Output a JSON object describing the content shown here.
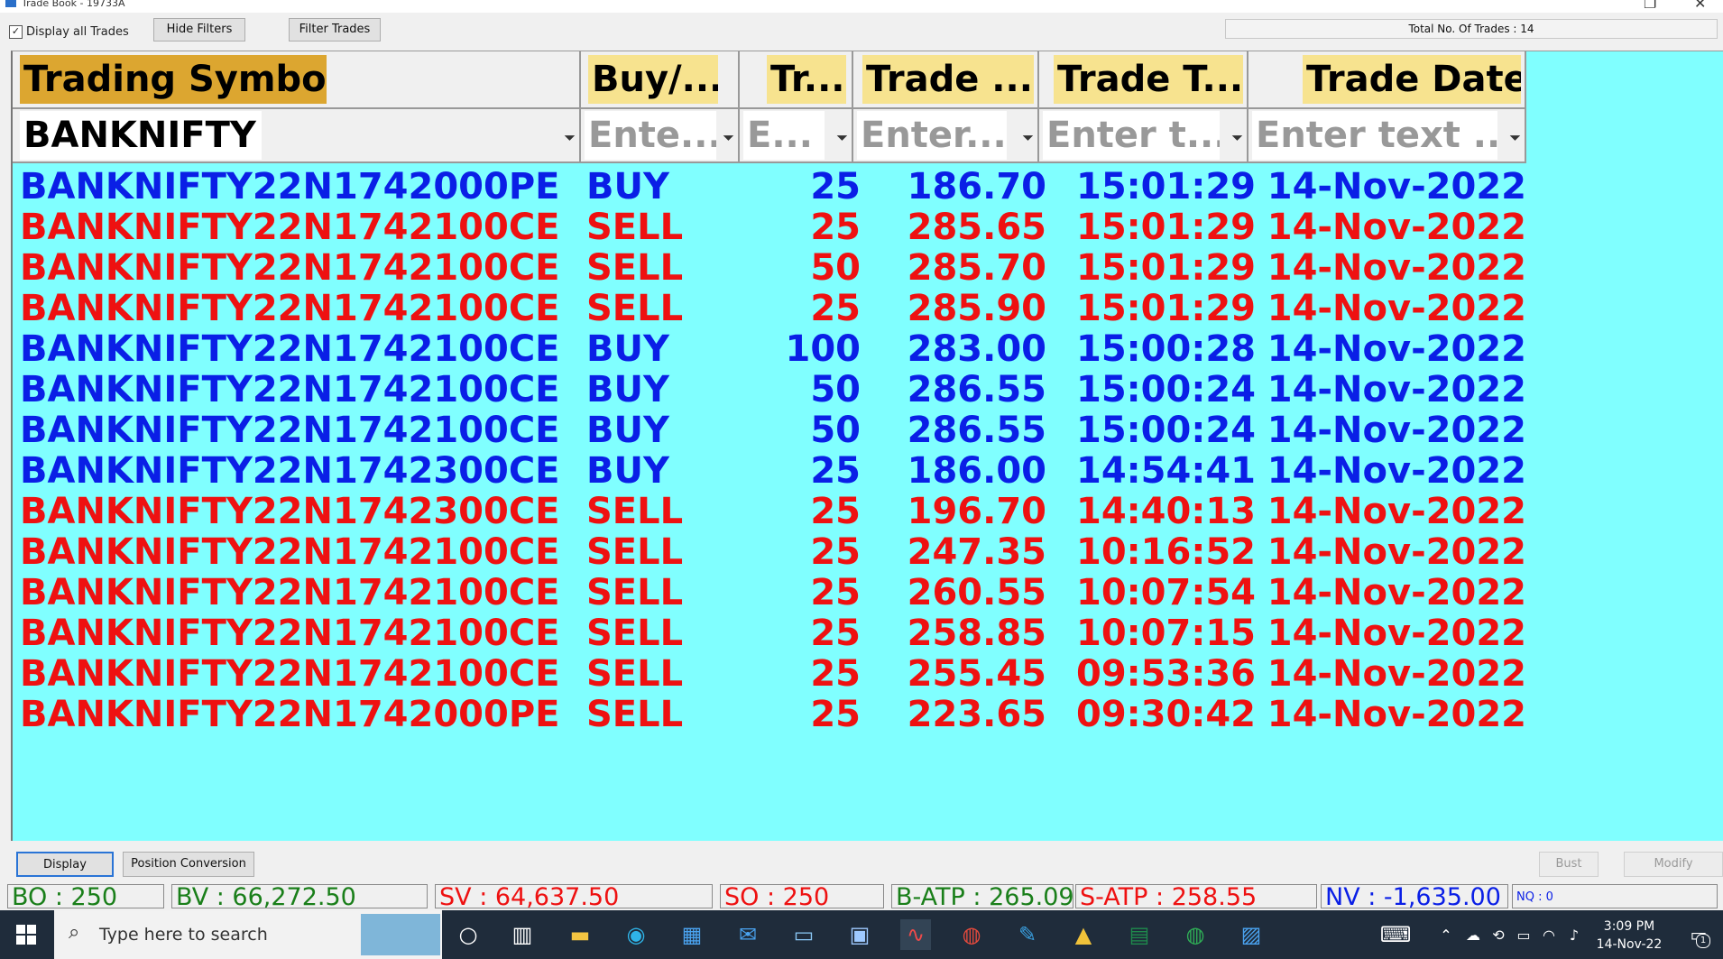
{
  "window": {
    "title": "Trade Book - 19733A"
  },
  "toolbar": {
    "display_all_label": "Display all Trades",
    "display_all_checked": "✓",
    "hide_filters_label": "Hide Filters",
    "filter_trades_label": "Filter Trades",
    "total_trades_text": "Total No. Of Trades : 14"
  },
  "grid": {
    "headers": [
      "Trading Symbol",
      "Buy/...",
      "Tr...",
      "Trade ...",
      "Trade T...",
      "Trade Date"
    ],
    "filters": [
      "BANKNIFTY",
      "Ente...",
      "E...",
      "Enter...",
      "Enter t...",
      "Enter text ..."
    ],
    "rows": [
      {
        "symbol": "BANKNIFTY22N1742000PE",
        "side": "BUY",
        "qty": "25",
        "price": "186.70",
        "time": "15:01:29",
        "date": "14-Nov-2022"
      },
      {
        "symbol": "BANKNIFTY22N1742100CE",
        "side": "SELL",
        "qty": "25",
        "price": "285.65",
        "time": "15:01:29",
        "date": "14-Nov-2022"
      },
      {
        "symbol": "BANKNIFTY22N1742100CE",
        "side": "SELL",
        "qty": "50",
        "price": "285.70",
        "time": "15:01:29",
        "date": "14-Nov-2022"
      },
      {
        "symbol": "BANKNIFTY22N1742100CE",
        "side": "SELL",
        "qty": "25",
        "price": "285.90",
        "time": "15:01:29",
        "date": "14-Nov-2022"
      },
      {
        "symbol": "BANKNIFTY22N1742100CE",
        "side": "BUY",
        "qty": "100",
        "price": "283.00",
        "time": "15:00:28",
        "date": "14-Nov-2022"
      },
      {
        "symbol": "BANKNIFTY22N1742100CE",
        "side": "BUY",
        "qty": "50",
        "price": "286.55",
        "time": "15:00:24",
        "date": "14-Nov-2022"
      },
      {
        "symbol": "BANKNIFTY22N1742100CE",
        "side": "BUY",
        "qty": "50",
        "price": "286.55",
        "time": "15:00:24",
        "date": "14-Nov-2022"
      },
      {
        "symbol": "BANKNIFTY22N1742300CE",
        "side": "BUY",
        "qty": "25",
        "price": "186.00",
        "time": "14:54:41",
        "date": "14-Nov-2022"
      },
      {
        "symbol": "BANKNIFTY22N1742300CE",
        "side": "SELL",
        "qty": "25",
        "price": "196.70",
        "time": "14:40:13",
        "date": "14-Nov-2022"
      },
      {
        "symbol": "BANKNIFTY22N1742100CE",
        "side": "SELL",
        "qty": "25",
        "price": "247.35",
        "time": "10:16:52",
        "date": "14-Nov-2022"
      },
      {
        "symbol": "BANKNIFTY22N1742100CE",
        "side": "SELL",
        "qty": "25",
        "price": "260.55",
        "time": "10:07:54",
        "date": "14-Nov-2022"
      },
      {
        "symbol": "BANKNIFTY22N1742100CE",
        "side": "SELL",
        "qty": "25",
        "price": "258.85",
        "time": "10:07:15",
        "date": "14-Nov-2022"
      },
      {
        "symbol": "BANKNIFTY22N1742100CE",
        "side": "SELL",
        "qty": "25",
        "price": "255.45",
        "time": "09:53:36",
        "date": "14-Nov-2022"
      },
      {
        "symbol": "BANKNIFTY22N1742000PE",
        "side": "SELL",
        "qty": "25",
        "price": "223.65",
        "time": "09:30:42",
        "date": "14-Nov-2022"
      }
    ]
  },
  "colors": {
    "grid_background": "#80ffff",
    "buy": "#0a1fe6",
    "sell": "#ee1111",
    "header_symbol_bg": "#dca630",
    "header_bg": "#f7e38f"
  },
  "bottom": {
    "display_label": "Display",
    "position_conversion_label": "Position Conversion",
    "bust_label": "Bust",
    "modify_label": "Modify"
  },
  "status": {
    "bo": "BO : 250",
    "bv": "BV : 66,272.50",
    "sv": "SV : 64,637.50",
    "so": "SO : 250",
    "batp": "B-ATP : 265.09",
    "satp": "S-ATP : 258.55",
    "nv": "NV : -1,635.00",
    "nq": "NQ : 0"
  },
  "taskbar": {
    "search_placeholder": "Type here to search",
    "time": "3:09 PM",
    "date": "14-Nov-22",
    "notification_count": "1"
  }
}
